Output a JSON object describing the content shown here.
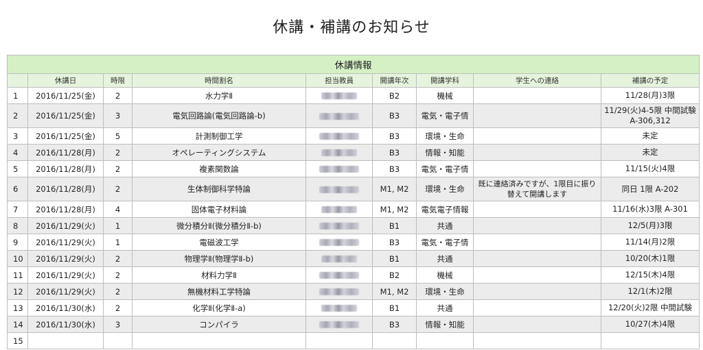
{
  "page": {
    "title": "休講・補講のお知らせ"
  },
  "table": {
    "caption": "休講情報",
    "columns": [
      "",
      "休講日",
      "時限",
      "時間割名",
      "担当教員",
      "開講年次",
      "開講学科",
      "学生への連絡",
      "補講の予定"
    ],
    "rows": [
      {
        "no": "1",
        "date": "2016/11/25(金)",
        "period": "2",
        "course": "水力学Ⅱ",
        "grade": "B2",
        "dept": "機械",
        "contact": "",
        "makeup": "11/28(月)3限"
      },
      {
        "no": "2",
        "date": "2016/11/25(金)",
        "period": "3",
        "course": "電気回路論(電気回路論-b)",
        "grade": "B3",
        "dept": "電気・電子情",
        "contact": "",
        "makeup": "11/29(火)4-5限 中間試験 A-306,312"
      },
      {
        "no": "3",
        "date": "2016/11/25(金)",
        "period": "5",
        "course": "計測制御工学",
        "grade": "B3",
        "dept": "環境・生命",
        "contact": "",
        "makeup": "未定"
      },
      {
        "no": "4",
        "date": "2016/11/28(月)",
        "period": "2",
        "course": "オペレーティングシステム",
        "grade": "B3",
        "dept": "情報・知能",
        "contact": "",
        "makeup": "未定"
      },
      {
        "no": "5",
        "date": "2016/11/28(月)",
        "period": "2",
        "course": "複素関数論",
        "grade": "B3",
        "dept": "電気・電子情",
        "contact": "",
        "makeup": "11/15(火)4限"
      },
      {
        "no": "6",
        "date": "2016/11/28(月)",
        "period": "2",
        "course": "生体制御科学特論",
        "grade": "M1, M2",
        "dept": "環境・生命",
        "contact": "既に連絡済みですが、1限目に振り替えて開講します",
        "makeup": "同日 1限 A-202"
      },
      {
        "no": "7",
        "date": "2016/11/28(月)",
        "period": "4",
        "course": "固体電子材料論",
        "grade": "M1, M2",
        "dept": "電気電子情報",
        "contact": "",
        "makeup": "11/16(水)3限 A-301"
      },
      {
        "no": "8",
        "date": "2016/11/29(火)",
        "period": "1",
        "course": "微分積分Ⅱ(微分積分Ⅱ-b)",
        "grade": "B1",
        "dept": "共通",
        "contact": "",
        "makeup": "12/5(月)3限"
      },
      {
        "no": "9",
        "date": "2016/11/29(火)",
        "period": "1",
        "course": "電磁波工学",
        "grade": "B3",
        "dept": "電気・電子情",
        "contact": "",
        "makeup": "11/14(月)2限"
      },
      {
        "no": "10",
        "date": "2016/11/29(火)",
        "period": "2",
        "course": "物理学Ⅱ(物理学Ⅱ-b)",
        "grade": "B1",
        "dept": "共通",
        "contact": "",
        "makeup": "10/20(木)1限"
      },
      {
        "no": "11",
        "date": "2016/11/29(火)",
        "period": "2",
        "course": "材料力学Ⅱ",
        "grade": "B2",
        "dept": "機械",
        "contact": "",
        "makeup": "12/15(木)4限"
      },
      {
        "no": "12",
        "date": "2016/11/29(火)",
        "period": "2",
        "course": "無機材料工学特論",
        "grade": "M1, M2",
        "dept": "環境・生命",
        "contact": "",
        "makeup": "12/1(木)2限"
      },
      {
        "no": "13",
        "date": "2016/11/30(水)",
        "period": "2",
        "course": "化学Ⅱ(化学Ⅱ-a)",
        "grade": "B1",
        "dept": "共通",
        "contact": "",
        "makeup": "12/20(火)2限 中間試験"
      },
      {
        "no": "14",
        "date": "2016/11/30(水)",
        "period": "3",
        "course": "コンパイラ",
        "grade": "B3",
        "dept": "情報・知能",
        "contact": "",
        "makeup": "10/27(木)4限"
      },
      {
        "no": "15",
        "date": "",
        "period": "",
        "course": "",
        "grade": "",
        "dept": "",
        "contact": "",
        "makeup": ""
      }
    ]
  }
}
